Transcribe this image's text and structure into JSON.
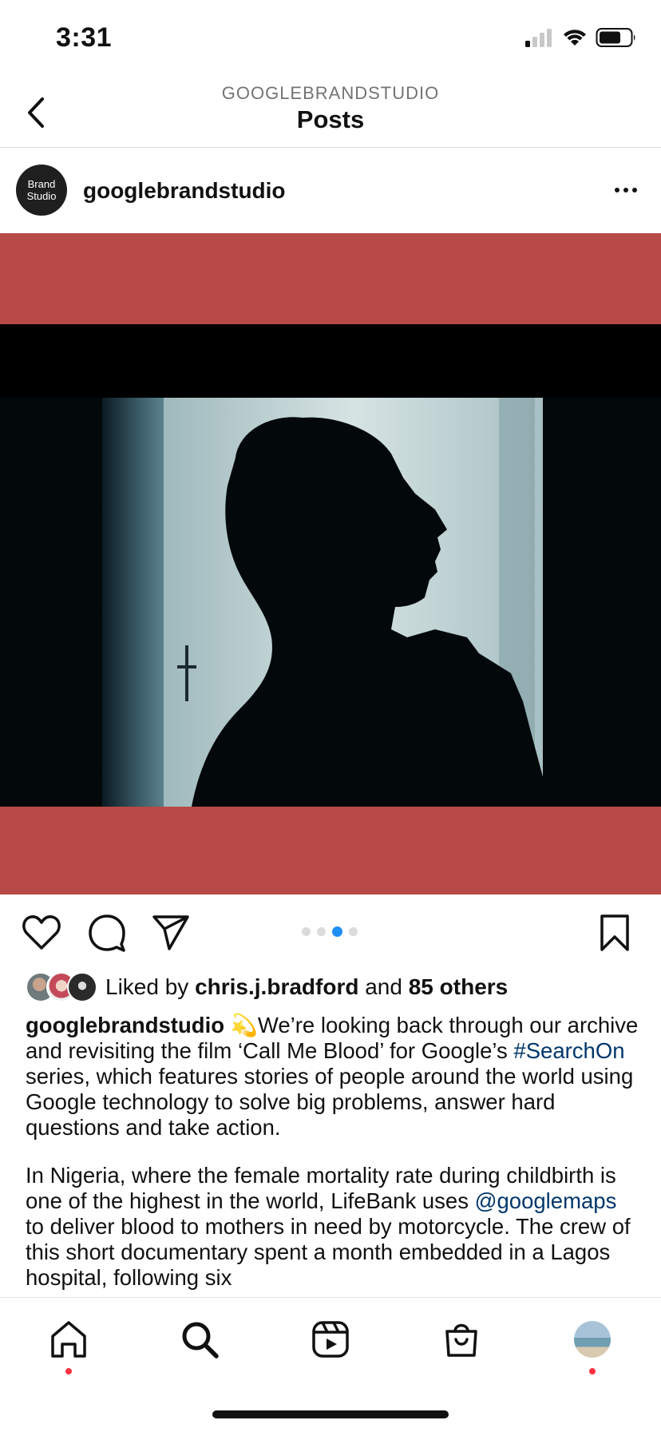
{
  "status_bar": {
    "time": "3:31"
  },
  "header": {
    "subtitle": "GOOGLEBRANDSTUDIO",
    "title": "Posts"
  },
  "post": {
    "avatar_line1": "Brand",
    "avatar_line2": "Studio",
    "username": "googlebrandstudio",
    "carousel": {
      "count": 4,
      "active_index": 2
    },
    "likes": {
      "prefix": "Liked by",
      "user": "chris.j.bradford",
      "middle": "and",
      "others": "85 others"
    },
    "caption": {
      "author": "googlebrandstudio",
      "emoji": "💫",
      "text_1": "We’re looking back through our archive and revisiting the film ‘Call Me Blood’ for Google’s",
      "hashtag": "#SearchOn",
      "text_2": "series, which features stories of people around the world using Google technology to solve big problems, answer hard questions and take action.",
      "para2_1": "In Nigeria, where the female mortality rate during childbirth is one of the highest in the world, LifeBank uses",
      "mention": "@googlemaps",
      "para2_2": "to deliver blood to mothers in need by motorcycle. The crew of this short documentary spent a month embedded in a Lagos hospital, following six"
    }
  },
  "colors": {
    "media_bg": "#b74946",
    "link": "#00376b",
    "dot_active": "#1d8ff4",
    "notify_dot": "#ff3040"
  },
  "icons": {
    "back": "chevron-left-icon",
    "more": "more-horizontal-icon",
    "like": "heart-icon",
    "comment": "comment-icon",
    "share": "send-icon",
    "save": "bookmark-icon",
    "home": "home-icon",
    "search": "search-icon",
    "reels": "reels-icon",
    "shop": "shopping-bag-icon"
  }
}
